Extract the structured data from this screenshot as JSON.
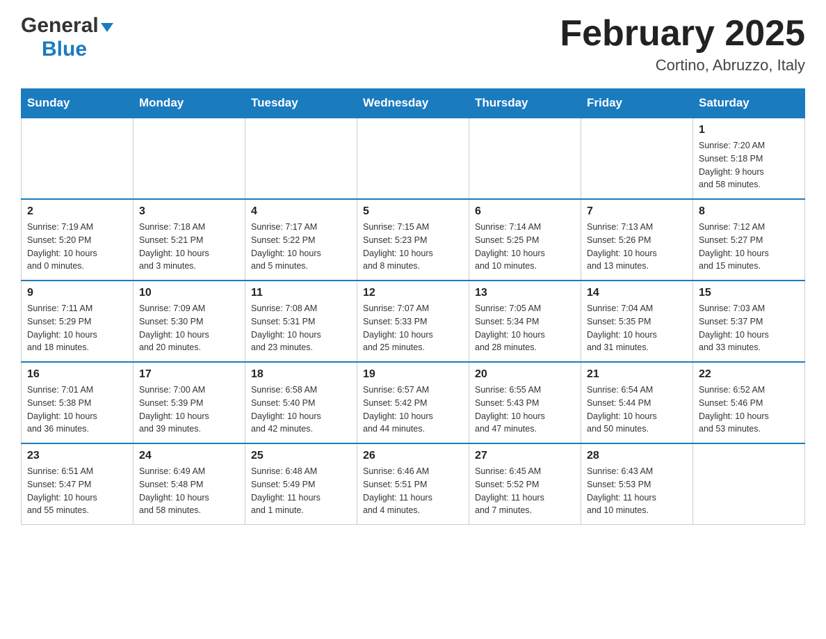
{
  "header": {
    "logo_general": "General",
    "logo_blue": "Blue",
    "title": "February 2025",
    "subtitle": "Cortino, Abruzzo, Italy"
  },
  "days_of_week": [
    "Sunday",
    "Monday",
    "Tuesday",
    "Wednesday",
    "Thursday",
    "Friday",
    "Saturday"
  ],
  "weeks": [
    [
      {
        "day": "",
        "info": ""
      },
      {
        "day": "",
        "info": ""
      },
      {
        "day": "",
        "info": ""
      },
      {
        "day": "",
        "info": ""
      },
      {
        "day": "",
        "info": ""
      },
      {
        "day": "",
        "info": ""
      },
      {
        "day": "1",
        "info": "Sunrise: 7:20 AM\nSunset: 5:18 PM\nDaylight: 9 hours\nand 58 minutes."
      }
    ],
    [
      {
        "day": "2",
        "info": "Sunrise: 7:19 AM\nSunset: 5:20 PM\nDaylight: 10 hours\nand 0 minutes."
      },
      {
        "day": "3",
        "info": "Sunrise: 7:18 AM\nSunset: 5:21 PM\nDaylight: 10 hours\nand 3 minutes."
      },
      {
        "day": "4",
        "info": "Sunrise: 7:17 AM\nSunset: 5:22 PM\nDaylight: 10 hours\nand 5 minutes."
      },
      {
        "day": "5",
        "info": "Sunrise: 7:15 AM\nSunset: 5:23 PM\nDaylight: 10 hours\nand 8 minutes."
      },
      {
        "day": "6",
        "info": "Sunrise: 7:14 AM\nSunset: 5:25 PM\nDaylight: 10 hours\nand 10 minutes."
      },
      {
        "day": "7",
        "info": "Sunrise: 7:13 AM\nSunset: 5:26 PM\nDaylight: 10 hours\nand 13 minutes."
      },
      {
        "day": "8",
        "info": "Sunrise: 7:12 AM\nSunset: 5:27 PM\nDaylight: 10 hours\nand 15 minutes."
      }
    ],
    [
      {
        "day": "9",
        "info": "Sunrise: 7:11 AM\nSunset: 5:29 PM\nDaylight: 10 hours\nand 18 minutes."
      },
      {
        "day": "10",
        "info": "Sunrise: 7:09 AM\nSunset: 5:30 PM\nDaylight: 10 hours\nand 20 minutes."
      },
      {
        "day": "11",
        "info": "Sunrise: 7:08 AM\nSunset: 5:31 PM\nDaylight: 10 hours\nand 23 minutes."
      },
      {
        "day": "12",
        "info": "Sunrise: 7:07 AM\nSunset: 5:33 PM\nDaylight: 10 hours\nand 25 minutes."
      },
      {
        "day": "13",
        "info": "Sunrise: 7:05 AM\nSunset: 5:34 PM\nDaylight: 10 hours\nand 28 minutes."
      },
      {
        "day": "14",
        "info": "Sunrise: 7:04 AM\nSunset: 5:35 PM\nDaylight: 10 hours\nand 31 minutes."
      },
      {
        "day": "15",
        "info": "Sunrise: 7:03 AM\nSunset: 5:37 PM\nDaylight: 10 hours\nand 33 minutes."
      }
    ],
    [
      {
        "day": "16",
        "info": "Sunrise: 7:01 AM\nSunset: 5:38 PM\nDaylight: 10 hours\nand 36 minutes."
      },
      {
        "day": "17",
        "info": "Sunrise: 7:00 AM\nSunset: 5:39 PM\nDaylight: 10 hours\nand 39 minutes."
      },
      {
        "day": "18",
        "info": "Sunrise: 6:58 AM\nSunset: 5:40 PM\nDaylight: 10 hours\nand 42 minutes."
      },
      {
        "day": "19",
        "info": "Sunrise: 6:57 AM\nSunset: 5:42 PM\nDaylight: 10 hours\nand 44 minutes."
      },
      {
        "day": "20",
        "info": "Sunrise: 6:55 AM\nSunset: 5:43 PM\nDaylight: 10 hours\nand 47 minutes."
      },
      {
        "day": "21",
        "info": "Sunrise: 6:54 AM\nSunset: 5:44 PM\nDaylight: 10 hours\nand 50 minutes."
      },
      {
        "day": "22",
        "info": "Sunrise: 6:52 AM\nSunset: 5:46 PM\nDaylight: 10 hours\nand 53 minutes."
      }
    ],
    [
      {
        "day": "23",
        "info": "Sunrise: 6:51 AM\nSunset: 5:47 PM\nDaylight: 10 hours\nand 55 minutes."
      },
      {
        "day": "24",
        "info": "Sunrise: 6:49 AM\nSunset: 5:48 PM\nDaylight: 10 hours\nand 58 minutes."
      },
      {
        "day": "25",
        "info": "Sunrise: 6:48 AM\nSunset: 5:49 PM\nDaylight: 11 hours\nand 1 minute."
      },
      {
        "day": "26",
        "info": "Sunrise: 6:46 AM\nSunset: 5:51 PM\nDaylight: 11 hours\nand 4 minutes."
      },
      {
        "day": "27",
        "info": "Sunrise: 6:45 AM\nSunset: 5:52 PM\nDaylight: 11 hours\nand 7 minutes."
      },
      {
        "day": "28",
        "info": "Sunrise: 6:43 AM\nSunset: 5:53 PM\nDaylight: 11 hours\nand 10 minutes."
      },
      {
        "day": "",
        "info": ""
      }
    ]
  ]
}
